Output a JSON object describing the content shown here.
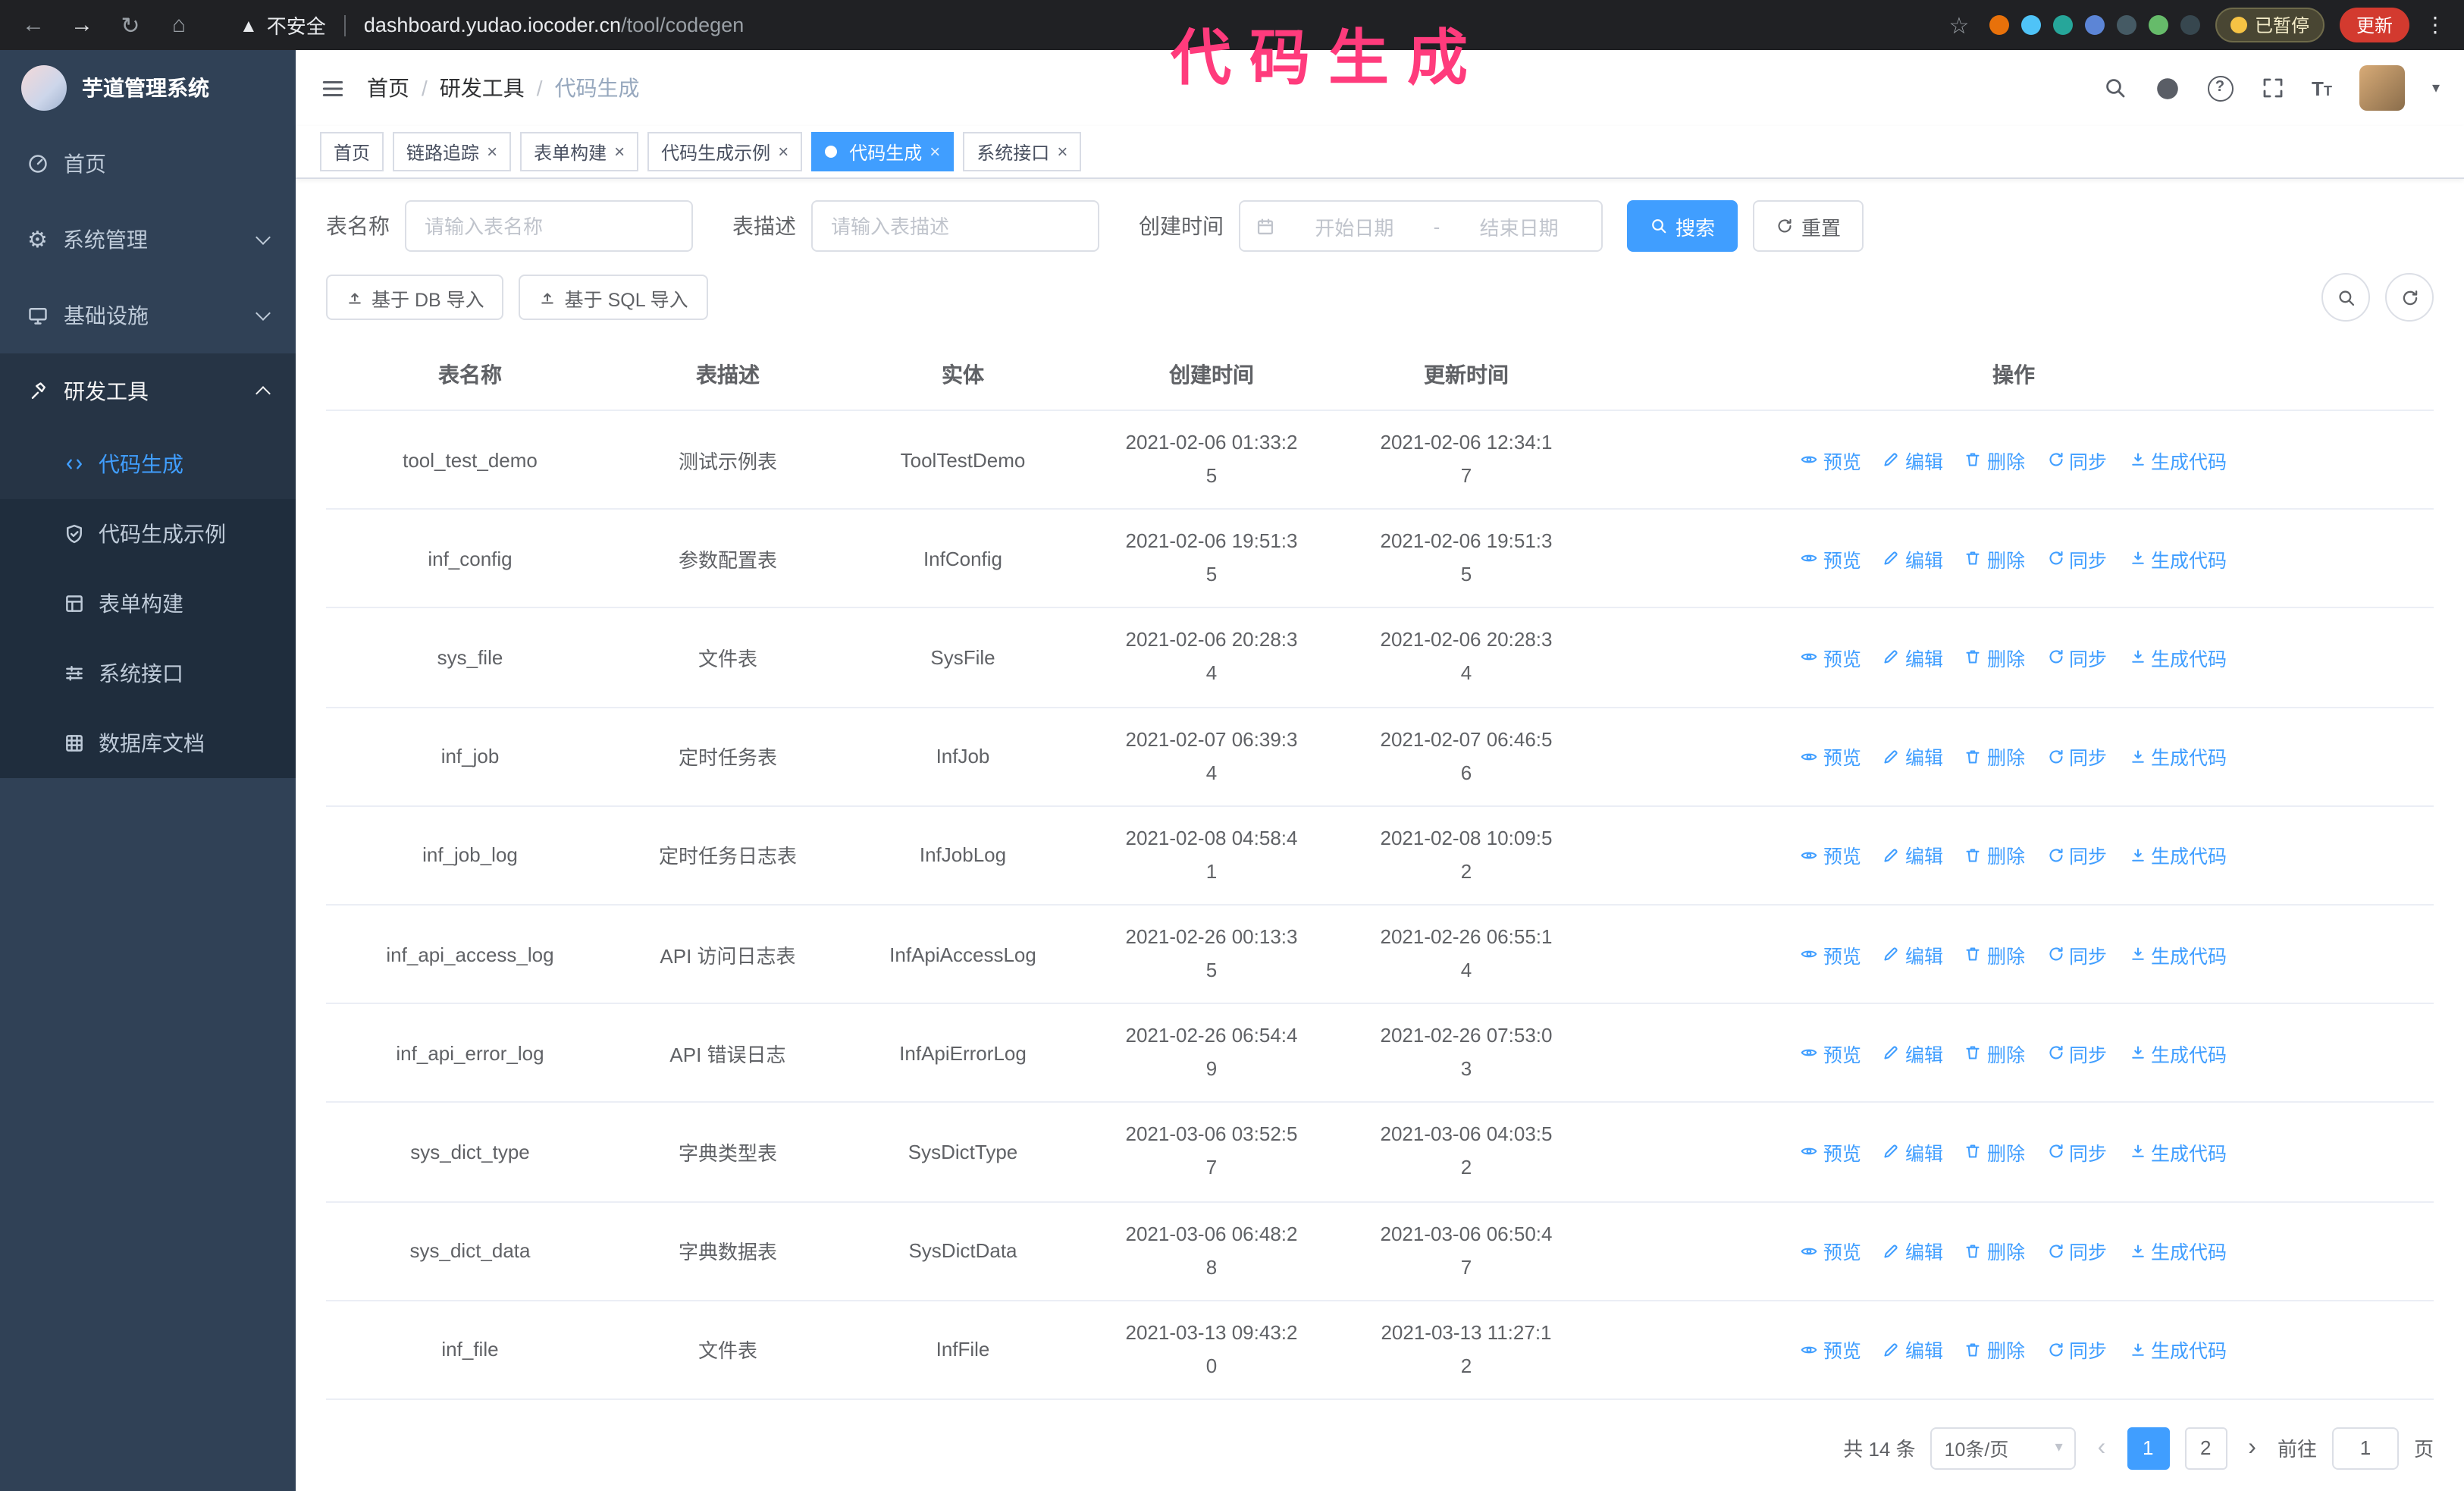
{
  "theme": {
    "accent": "#409eff",
    "sidebar-bg": "#304156",
    "submenu-bg": "#1f2d3d",
    "annotation": "#ff3b7c"
  },
  "annotation": {
    "text": "代码生成"
  },
  "browser": {
    "security_label": "不安全",
    "url_host": "dashboard.yudao.iocoder.cn",
    "url_path": "/tool/codegen",
    "paused_label": "已暂停",
    "update_label": "更新",
    "extension_colors": [
      "#e8710a",
      "#4fc3f7",
      "#26a69a",
      "#5c85d6",
      "#455a64",
      "#66bb6a",
      "#37474f"
    ]
  },
  "sidebar": {
    "app_title": "芋道管理系统",
    "items": [
      {
        "label": "首页"
      },
      {
        "label": "系统管理"
      },
      {
        "label": "基础设施"
      },
      {
        "label": "研发工具"
      }
    ],
    "submenu": [
      {
        "label": "代码生成"
      },
      {
        "label": "代码生成示例"
      },
      {
        "label": "表单构建"
      },
      {
        "label": "系统接口"
      },
      {
        "label": "数据库文档"
      }
    ]
  },
  "breadcrumb": {
    "items": [
      "首页",
      "研发工具",
      "代码生成"
    ],
    "separator": "/"
  },
  "tabs": [
    {
      "label": "首页"
    },
    {
      "label": "链路追踪"
    },
    {
      "label": "表单构建"
    },
    {
      "label": "代码生成示例"
    },
    {
      "label": "代码生成"
    },
    {
      "label": "系统接口"
    }
  ],
  "filters": {
    "name_label": "表名称",
    "name_placeholder": "请输入表名称",
    "desc_label": "表描述",
    "desc_placeholder": "请输入表描述",
    "time_label": "创建时间",
    "start_placeholder": "开始日期",
    "range_separator": "-",
    "end_placeholder": "结束日期",
    "search_label": "搜索",
    "reset_label": "重置"
  },
  "toolbar": {
    "import_db_label": "基于 DB 导入",
    "import_sql_label": "基于 SQL 导入"
  },
  "table": {
    "columns": [
      "表名称",
      "表描述",
      "实体",
      "创建时间",
      "更新时间",
      "操作"
    ],
    "action_labels": {
      "preview": "预览",
      "edit": "编辑",
      "delete": "删除",
      "sync": "同步",
      "generate": "生成代码"
    },
    "rows": [
      {
        "name": "tool_test_demo",
        "desc": "测试示例表",
        "entity": "ToolTestDemo",
        "created": "2021-02-06 01:33:25",
        "updated": "2021-02-06 12:34:17"
      },
      {
        "name": "inf_config",
        "desc": "参数配置表",
        "entity": "InfConfig",
        "created": "2021-02-06 19:51:35",
        "updated": "2021-02-06 19:51:35"
      },
      {
        "name": "sys_file",
        "desc": "文件表",
        "entity": "SysFile",
        "created": "2021-02-06 20:28:34",
        "updated": "2021-02-06 20:28:34"
      },
      {
        "name": "inf_job",
        "desc": "定时任务表",
        "entity": "InfJob",
        "created": "2021-02-07 06:39:34",
        "updated": "2021-02-07 06:46:56"
      },
      {
        "name": "inf_job_log",
        "desc": "定时任务日志表",
        "entity": "InfJobLog",
        "created": "2021-02-08 04:58:41",
        "updated": "2021-02-08 10:09:52"
      },
      {
        "name": "inf_api_access_log",
        "desc": "API 访问日志表",
        "entity": "InfApiAccessLog",
        "created": "2021-02-26 00:13:35",
        "updated": "2021-02-26 06:55:14"
      },
      {
        "name": "inf_api_error_log",
        "desc": "API 错误日志",
        "entity": "InfApiErrorLog",
        "created": "2021-02-26 06:54:49",
        "updated": "2021-02-26 07:53:03"
      },
      {
        "name": "sys_dict_type",
        "desc": "字典类型表",
        "entity": "SysDictType",
        "created": "2021-03-06 03:52:57",
        "updated": "2021-03-06 04:03:52"
      },
      {
        "name": "sys_dict_data",
        "desc": "字典数据表",
        "entity": "SysDictData",
        "created": "2021-03-06 06:48:28",
        "updated": "2021-03-06 06:50:47"
      },
      {
        "name": "inf_file",
        "desc": "文件表",
        "entity": "InfFile",
        "created": "2021-03-13 09:43:20",
        "updated": "2021-03-13 11:27:12"
      }
    ]
  },
  "pagination": {
    "total": "共 14 条",
    "page_size": "10条/页",
    "pages": [
      "1",
      "2"
    ],
    "goto_label": "前往",
    "goto_value": "1",
    "goto_suffix": "页"
  }
}
